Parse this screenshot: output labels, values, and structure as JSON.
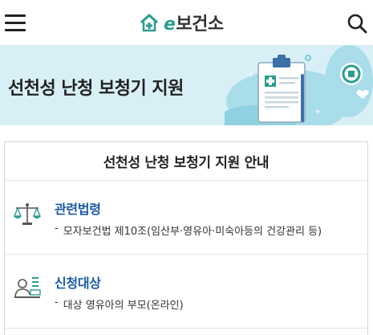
{
  "header": {
    "logo_prefix": "e",
    "logo_text": "보건소",
    "menu_icon": "hamburger-menu-icon",
    "search_icon": "search-icon"
  },
  "banner": {
    "title": "선천성 난청 보청기 지원",
    "illustration": "clipboard-health-illustration"
  },
  "card": {
    "title": "선천성 난청 보청기 지원 안내",
    "sections": [
      {
        "icon": "scale-icon",
        "title": "관련법령",
        "bullet": "-",
        "item": "모자보건법 제10조(임산부·영유아·미숙아등의 건강관리 등)"
      },
      {
        "icon": "person-desk-icon",
        "title": "신청대상",
        "bullet": "-",
        "item": "대상 영유아의 부모(온라인)"
      }
    ]
  },
  "colors": {
    "brand": "#2a9d8f",
    "banner_bg": "#d8eff6",
    "section_title": "#1c5aa6"
  }
}
